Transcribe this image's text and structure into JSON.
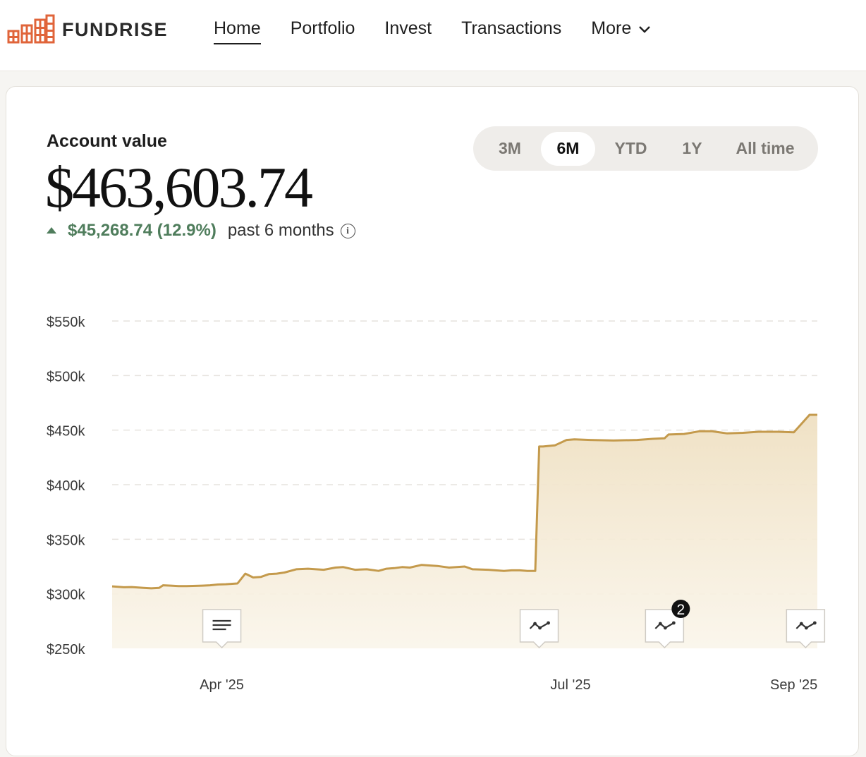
{
  "brand": {
    "name": "FUNDRISE",
    "logo_color": "#e0643a"
  },
  "nav": {
    "items": [
      {
        "label": "Home",
        "active": true
      },
      {
        "label": "Portfolio",
        "active": false
      },
      {
        "label": "Invest",
        "active": false
      },
      {
        "label": "Transactions",
        "active": false
      }
    ],
    "more_label": "More"
  },
  "account": {
    "label": "Account value",
    "value": "$463,603.74",
    "change": "$45,268.74 (12.9%)",
    "change_direction": "up",
    "change_color": "#4f7d5c",
    "period": "past 6 months"
  },
  "ranges": [
    {
      "label": "3M",
      "selected": false
    },
    {
      "label": "6M",
      "selected": true
    },
    {
      "label": "YTD",
      "selected": false
    },
    {
      "label": "1Y",
      "selected": false
    },
    {
      "label": "All time",
      "selected": false
    }
  ],
  "markers": [
    {
      "kind": "document",
      "icon": "document-icon",
      "badge": ""
    },
    {
      "kind": "trend",
      "icon": "trend-icon",
      "badge": ""
    },
    {
      "kind": "trend",
      "icon": "trend-icon",
      "badge": "2"
    },
    {
      "kind": "trend",
      "icon": "trend-icon",
      "badge": ""
    }
  ],
  "chart_data": {
    "type": "area",
    "ylim": [
      250000,
      550000
    ],
    "yticks": [
      550000,
      500000,
      450000,
      400000,
      350000,
      300000,
      250000
    ],
    "ytick_labels": [
      "$550k",
      "$500k",
      "$450k",
      "$400k",
      "$350k",
      "$300k",
      "$250k"
    ],
    "xlim": [
      0,
      180
    ],
    "xticks": [
      {
        "label": "Apr '25",
        "x": 28
      },
      {
        "label": "Jul '25",
        "x": 117
      },
      {
        "label": "Sep '25",
        "x": 174
      }
    ],
    "marker_x": [
      28,
      109,
      141,
      177
    ],
    "line_color": "#c49a4c",
    "fill_color": "#f0e3c8",
    "grid": true,
    "series": [
      {
        "x": [
          0,
          3,
          5,
          8,
          10,
          12,
          13,
          15,
          17,
          19,
          23,
          25,
          27,
          29,
          32,
          34,
          36,
          38,
          40,
          42,
          44,
          47,
          50,
          54,
          57,
          59,
          62,
          65,
          68,
          70,
          72,
          74,
          76,
          79,
          81,
          83,
          86,
          90,
          92,
          96,
          100,
          102,
          104,
          106,
          108,
          109,
          110,
          113,
          116,
          118,
          122,
          128,
          134,
          138,
          141,
          142,
          146,
          150,
          153,
          157,
          161,
          165,
          170,
          174,
          178,
          180
        ],
        "y": [
          306800,
          306000,
          306200,
          305500,
          305000,
          305500,
          307800,
          307500,
          307000,
          307000,
          307500,
          307800,
          308500,
          308800,
          309500,
          318500,
          315000,
          315500,
          318000,
          318500,
          319500,
          322500,
          323000,
          322000,
          324000,
          324500,
          322000,
          322500,
          321000,
          323000,
          323500,
          324500,
          324000,
          326500,
          326000,
          325500,
          324000,
          325000,
          322500,
          322000,
          321000,
          321500,
          321500,
          321000,
          321000,
          435000,
          435000,
          436000,
          441000,
          441500,
          441000,
          440500,
          441000,
          442000,
          442500,
          446000,
          446500,
          449000,
          449000,
          447000,
          447500,
          448500,
          448500,
          448000,
          464000,
          464000
        ]
      }
    ]
  }
}
